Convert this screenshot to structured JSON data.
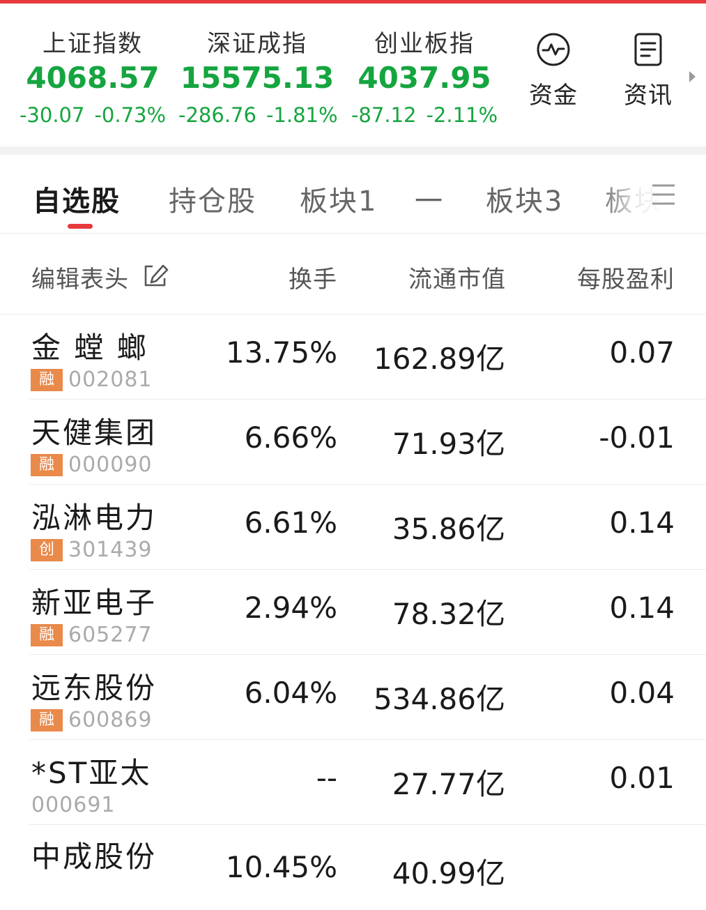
{
  "indices": [
    {
      "name": "上证指数",
      "value": "4068.57",
      "change": "-30.07",
      "pct": "-0.73%"
    },
    {
      "name": "深证成指",
      "value": "15575.13",
      "change": "-286.76",
      "pct": "-1.81%"
    },
    {
      "name": "创业板指",
      "value": "4037.95",
      "change": "-87.12",
      "pct": "-2.11%"
    }
  ],
  "quick_actions": [
    {
      "label": "资金",
      "icon": "pulse-icon"
    },
    {
      "label": "资讯",
      "icon": "document-icon"
    }
  ],
  "tabs": [
    "自选股",
    "持仓股",
    "板块1",
    "一",
    "板块3",
    "板块"
  ],
  "active_tab": "自选股",
  "table": {
    "edit_label": "编辑表头",
    "columns": [
      "换手",
      "流通市值",
      "每股盈利"
    ],
    "rows": [
      {
        "name": "金 螳 螂",
        "badge": "融",
        "code": "002081",
        "turnover": "13.75%",
        "market_cap": "162.89亿",
        "eps": "0.07"
      },
      {
        "name": "天健集团",
        "badge": "融",
        "code": "000090",
        "turnover": "6.66%",
        "market_cap": "71.93亿",
        "eps": "-0.01"
      },
      {
        "name": "泓淋电力",
        "badge": "创",
        "code": "301439",
        "turnover": "6.61%",
        "market_cap": "35.86亿",
        "eps": "0.14"
      },
      {
        "name": "新亚电子",
        "badge": "融",
        "code": "605277",
        "turnover": "2.94%",
        "market_cap": "78.32亿",
        "eps": "0.14"
      },
      {
        "name": "远东股份",
        "badge": "融",
        "code": "600869",
        "turnover": "6.04%",
        "market_cap": "534.86亿",
        "eps": "0.04"
      },
      {
        "name": "*ST亚太",
        "badge": "",
        "code": "000691",
        "turnover": "--",
        "market_cap": "27.77亿",
        "eps": "0.01"
      },
      {
        "name": "中成股份",
        "badge": "",
        "code": "",
        "turnover": "10.45%",
        "market_cap": "40.99亿",
        "eps": ""
      }
    ]
  },
  "colors": {
    "accent": "#e8383d",
    "down": "#15a53f",
    "badge": "#e9894a"
  }
}
